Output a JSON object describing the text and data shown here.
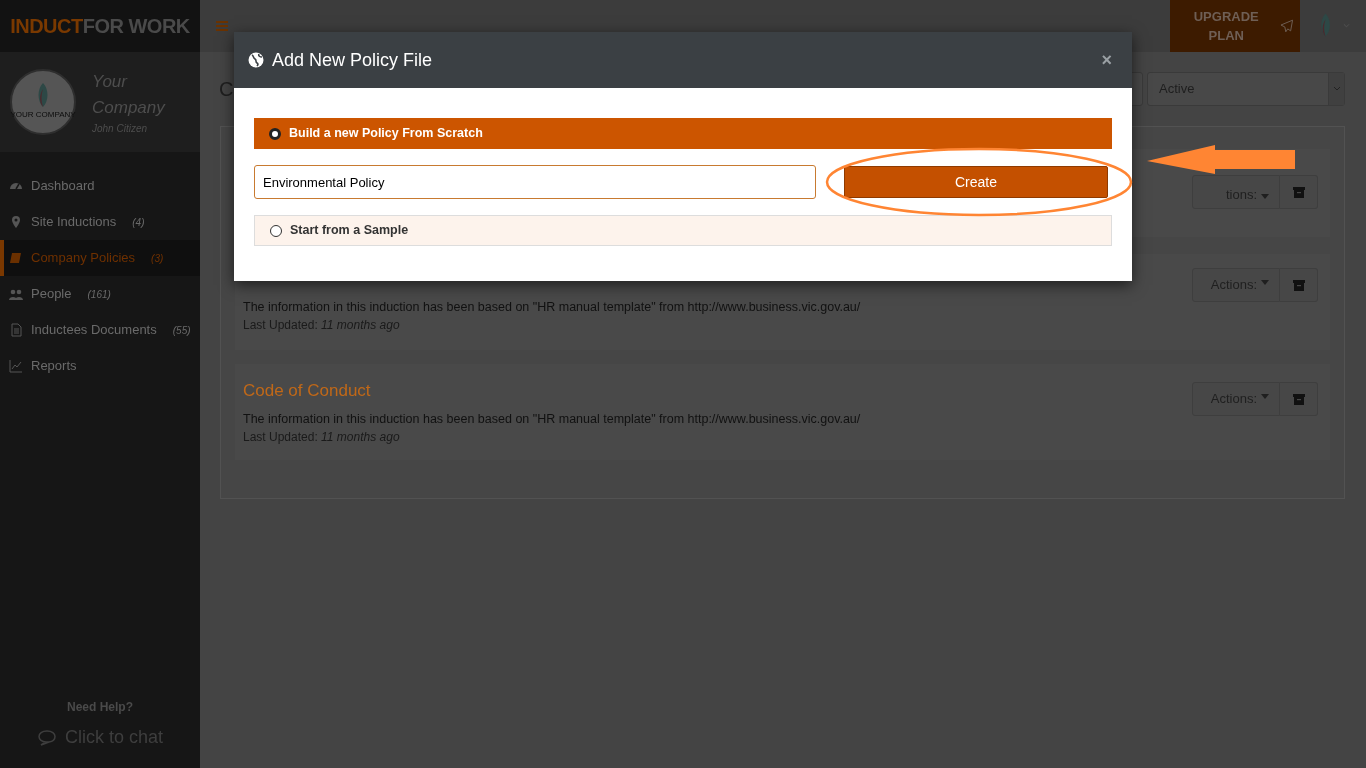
{
  "brand": {
    "logo_first": "INDUCT",
    "logo_second": "FOR WORK"
  },
  "profile": {
    "avatar_caption": "YOUR COMPANY",
    "company": "Your Company",
    "user": "John Citizen"
  },
  "sidebar": {
    "items": [
      {
        "label": "Dashboard",
        "selected": false
      },
      {
        "label": "Site Inductions",
        "count": "(4)",
        "selected": false
      },
      {
        "label": "Company Policies",
        "count": "(3)",
        "selected": true
      },
      {
        "label": "People",
        "count": "(161)",
        "selected": false
      },
      {
        "label": "Inductees Documents",
        "count": "(55)",
        "selected": false
      },
      {
        "label": "Reports",
        "selected": false
      }
    ],
    "help_title": "Need Help?",
    "chat_label": "Click to chat"
  },
  "topbar": {
    "upgrade_label": "UPGRADE PLAN"
  },
  "page": {
    "title": "C",
    "status_filter": {
      "value": "Active"
    },
    "policies": [
      {
        "actions_label": "tions:"
      },
      {
        "description": "The information in this induction has been based on \"HR manual template\" from http://www.business.vic.gov.au/",
        "updated_label": "Last Updated:",
        "updated_value": "11 months ago",
        "actions_label": "Actions:"
      },
      {
        "title": "Code of Conduct",
        "description": "The information in this induction has been based on \"HR manual template\" from http://www.business.vic.gov.au/",
        "updated_label": "Last Updated:",
        "updated_value": "11 months ago",
        "actions_label": "Actions:"
      }
    ]
  },
  "modal": {
    "title": "Add New Policy File",
    "close": "×",
    "options": [
      {
        "label": "Build a new Policy From Scratch",
        "selected": true
      },
      {
        "label": "Start from a Sample",
        "selected": false
      }
    ],
    "name_field": {
      "value": "Environmental Policy"
    },
    "create_label": "Create"
  }
}
